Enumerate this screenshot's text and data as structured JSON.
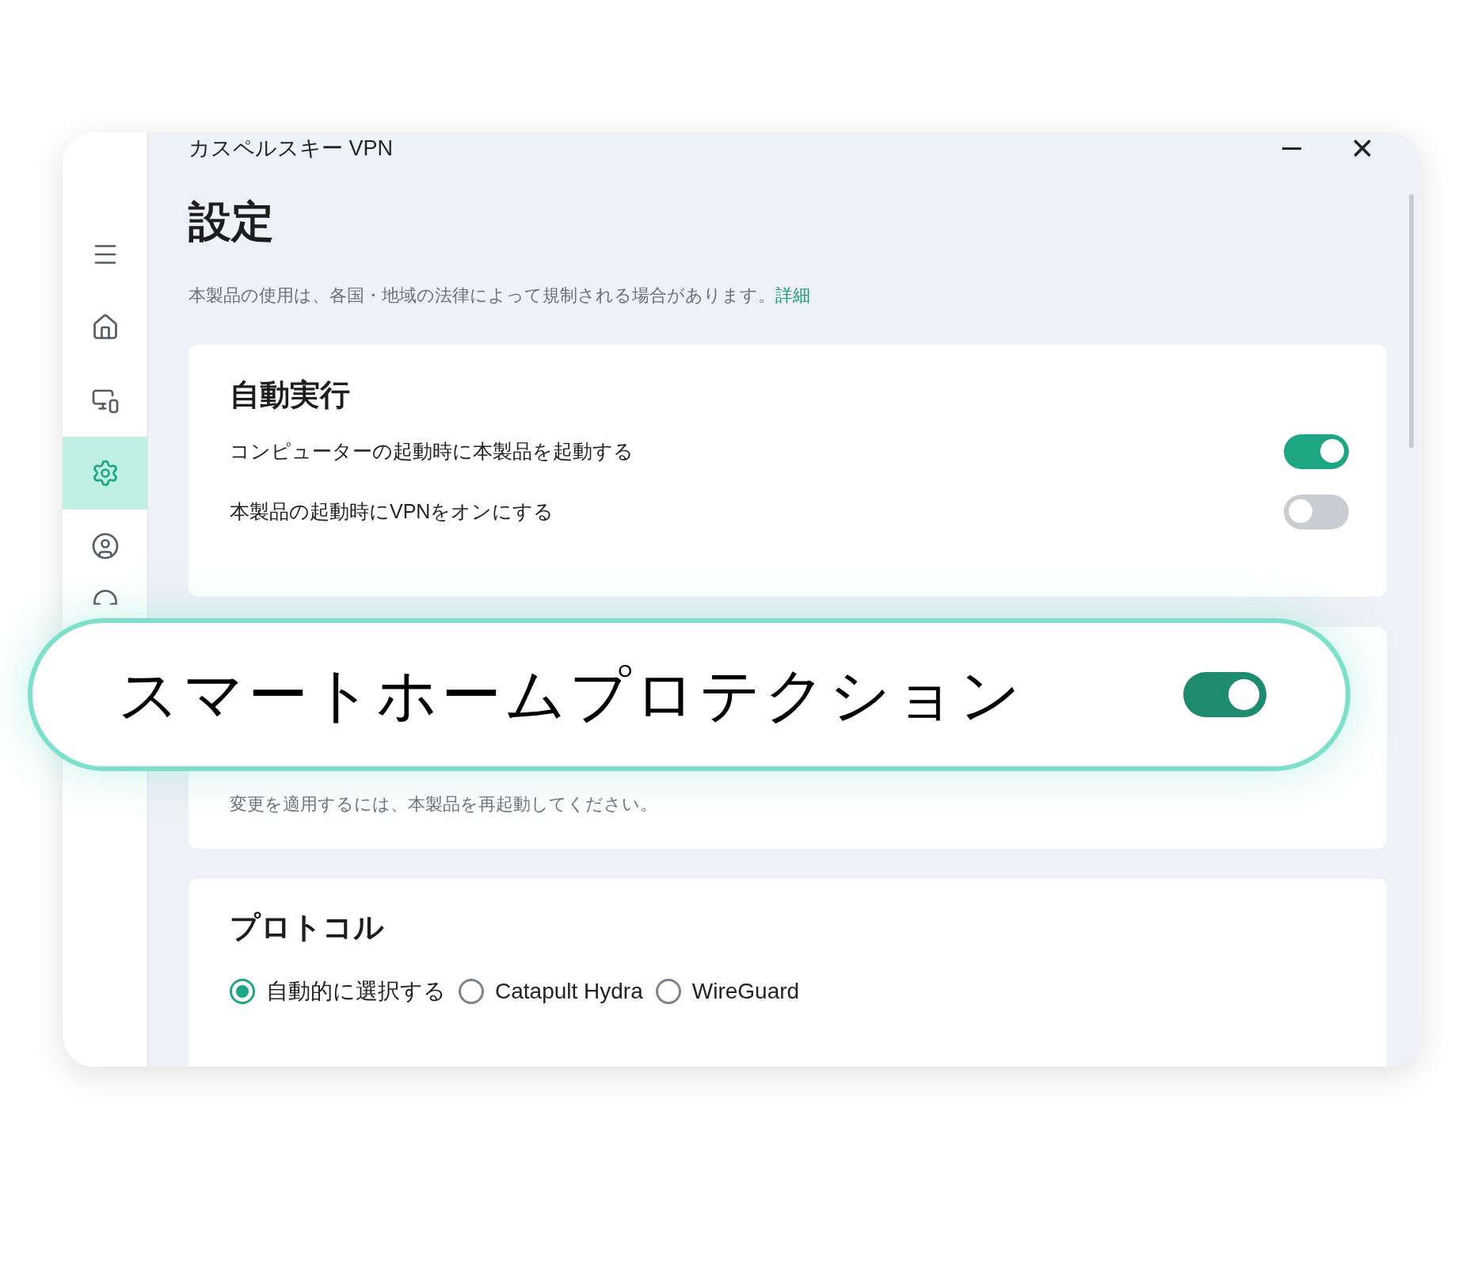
{
  "window": {
    "title": "カスペルスキー VPN"
  },
  "sidebar": {
    "items": [
      {
        "kind": "menu",
        "selected": false
      },
      {
        "kind": "home",
        "selected": false
      },
      {
        "kind": "devices",
        "selected": false
      },
      {
        "kind": "settings",
        "selected": true
      },
      {
        "kind": "account",
        "selected": false
      },
      {
        "kind": "support",
        "selected": false
      }
    ]
  },
  "page": {
    "heading": "設定",
    "notice": "本製品の使用は、各国・地域の法律によって規制される場合があります。",
    "notice_link": "詳細"
  },
  "sections": [
    {
      "kind": "toggles",
      "title": "自動実行",
      "items": [
        {
          "label": "コンピューターの起動時に本製品を起動する",
          "on": true
        },
        {
          "label": "本製品の起動時にVPNをオンにする",
          "on": false
        }
      ]
    },
    {
      "kind": "note",
      "note": "変更を適用するには、本製品を再起動してください。"
    },
    {
      "kind": "radios",
      "title": "プロトコル",
      "options": [
        {
          "label": "自動的に選択する",
          "selected": true
        },
        {
          "label": "Catapult Hydra",
          "selected": false
        },
        {
          "label": "WireGuard",
          "selected": false
        }
      ]
    }
  ],
  "callout": {
    "label": "スマートホームプロテクション",
    "on": true
  }
}
